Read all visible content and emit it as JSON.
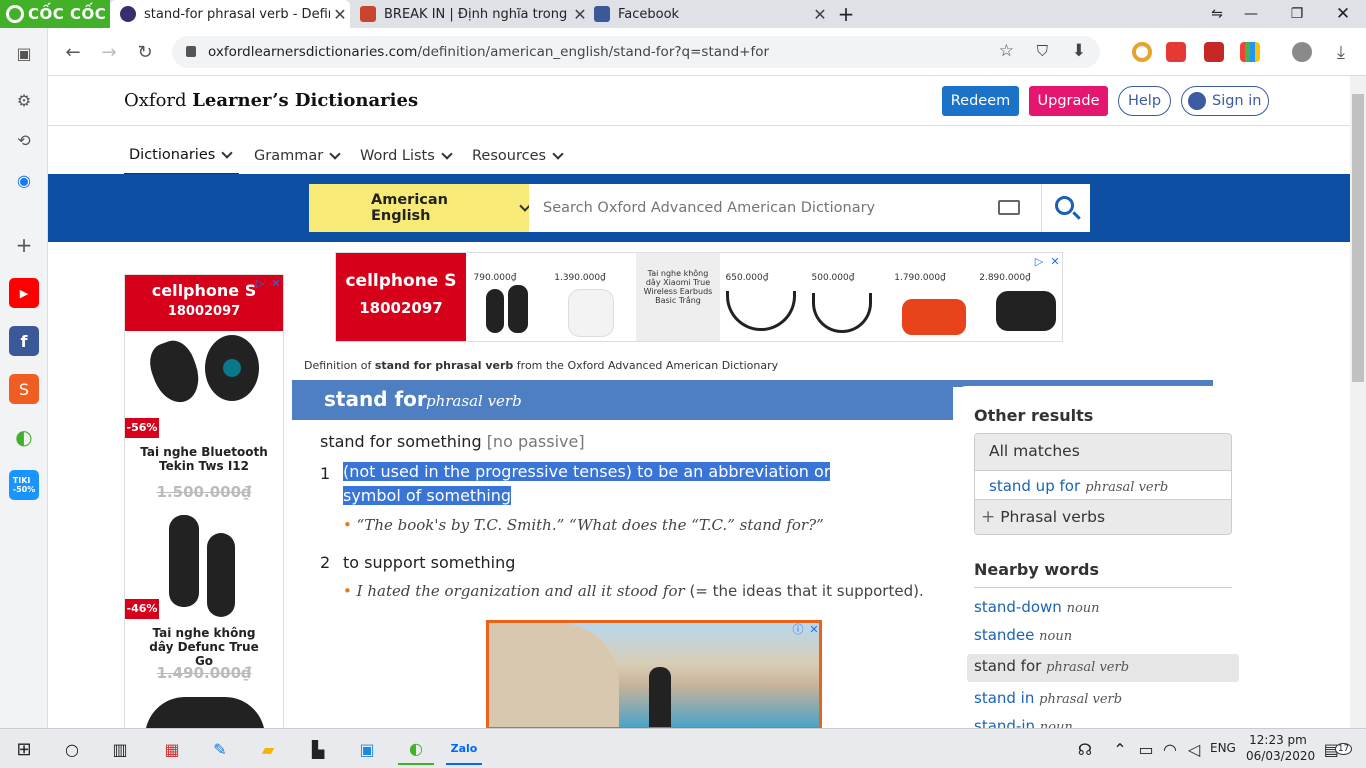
{
  "browser": {
    "brand": "CỐC CỐC",
    "tabs": [
      {
        "label": "stand-for phrasal verb - Defin",
        "active": true
      },
      {
        "label": "BREAK IN | Định nghĩa trong t",
        "active": false
      },
      {
        "label": "Facebook",
        "active": false
      }
    ],
    "new_tab": "+",
    "url_domain": "oxfordlearnersdictionaries.com",
    "url_path": "/definition/american_english/stand-for?q=stand+for"
  },
  "site": {
    "logo_prefix": "Oxford ",
    "logo_bold": "Learner’s Dictionaries",
    "redeem": "Redeem",
    "upgrade": "Upgrade",
    "help": "Help",
    "signin": "Sign in",
    "nav": [
      "Dictionaries",
      "Grammar",
      "Word Lists",
      "Resources"
    ],
    "language": "American English",
    "search_placeholder": "Search Oxford Advanced American Dictionary"
  },
  "ads": {
    "brand": "cellphone S",
    "phone": "18002097",
    "left_products": [
      {
        "discount": "-56%",
        "name": "Tai nghe Bluetooth Tekin Tws I12",
        "price": "1.500.000₫"
      },
      {
        "discount": "-46%",
        "name": "Tai nghe không dây Defunc True Go",
        "price": "1.490.000₫"
      }
    ],
    "banner_prices": [
      "790.000₫",
      "1.390.000₫",
      "650.000₫",
      "500.000₫",
      "1.790.000₫",
      "2.890.000₫"
    ],
    "banner_caption": "Tai nghe không dây Xiaomi True Wireless Earbuds Basic Trắng"
  },
  "entry": {
    "source_prefix": "Definition of ",
    "source_word": "stand for phrasal verb",
    "source_suffix": " from the Oxford Advanced American Dictionary",
    "headword": "stand for",
    "pos": "phrasal verb",
    "pattern": "stand for something",
    "pattern_note": "[no passive]",
    "senses": [
      {
        "num": "1",
        "def": "(not used in the progressive tenses) to be an abbreviation or symbol of something",
        "example": "“The book's by T.C. Smith.” “What does the “T.C.” stand for?”",
        "gloss": ""
      },
      {
        "num": "2",
        "def": "to support something",
        "example": "I hated the organization and all it stood for",
        "gloss": " (= the ideas that it supported)."
      }
    ]
  },
  "sidebar": {
    "other_results": "Other results",
    "all_matches": "All matches",
    "match_word": "stand up for",
    "match_pos": "phrasal verb",
    "phrasal_verbs": "Phrasal verbs",
    "nearby": "Nearby words",
    "nearby_words": [
      {
        "word": "stand-down",
        "pos": "noun"
      },
      {
        "word": "standee",
        "pos": "noun"
      },
      {
        "word": "stand for",
        "pos": "phrasal verb"
      },
      {
        "word": "stand in",
        "pos": "phrasal verb"
      },
      {
        "word": "stand-in",
        "pos": "noun"
      }
    ]
  },
  "taskbar": {
    "lang": "ENG",
    "time": "12:23 pm",
    "date": "06/03/2020",
    "notifications": "17"
  }
}
